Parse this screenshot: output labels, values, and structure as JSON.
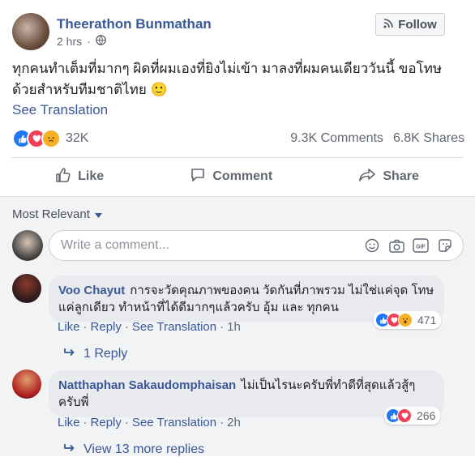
{
  "post": {
    "author": "Theerathon Bunmathan",
    "time": "2 hrs",
    "privacy_icon": "globe-icon",
    "follow_label": "Follow",
    "text": "ทุกคนทำเต็มที่มากๆ ผิดที่ผมเองที่ยิงไม่เข้า มาลงที่ผมคนเดียววันนี้ ขอโทษด้วยสำหรับทีมชาติไทย 🙂",
    "see_translation": "See Translation",
    "reaction_count": "32K",
    "comments_count": "9.3K Comments",
    "shares_count": "6.8K Shares"
  },
  "actions": {
    "like": "Like",
    "comment": "Comment",
    "share": "Share"
  },
  "sort": {
    "label": "Most Relevant"
  },
  "composer": {
    "placeholder": "Write a comment..."
  },
  "comments": [
    {
      "name": "Voo Chayut",
      "text": "การจะวัดคุณภาพของคน วัดกันที่ภาพรวม ไม่ใช่แค่จุด โทษแค่ลูกเดียว ทำหน้าที่ได้ดีมากๆแล้วครับ อุ้ม และ ทุกคน",
      "like": "Like",
      "reply": "Reply",
      "translation": "See Translation",
      "time": "1h",
      "reaction_count": "471",
      "replies": "1 Reply"
    },
    {
      "name": "Natthaphan Sakaudomphaisan",
      "text": "ไม่เป็นไรนะครับพี่ทำดีที่สุดแล้วสู้ๆครับพี่",
      "like": "Like",
      "reply": "Reply",
      "translation": "See Translation",
      "time": "2h",
      "reaction_count": "266",
      "replies": "View 13 more replies"
    }
  ],
  "separator": "·",
  "colors": {
    "link_blue": "#385898",
    "like_blue": "#2078f4",
    "love_red": "#f33e58",
    "sad_yellow": "#f7b125"
  }
}
